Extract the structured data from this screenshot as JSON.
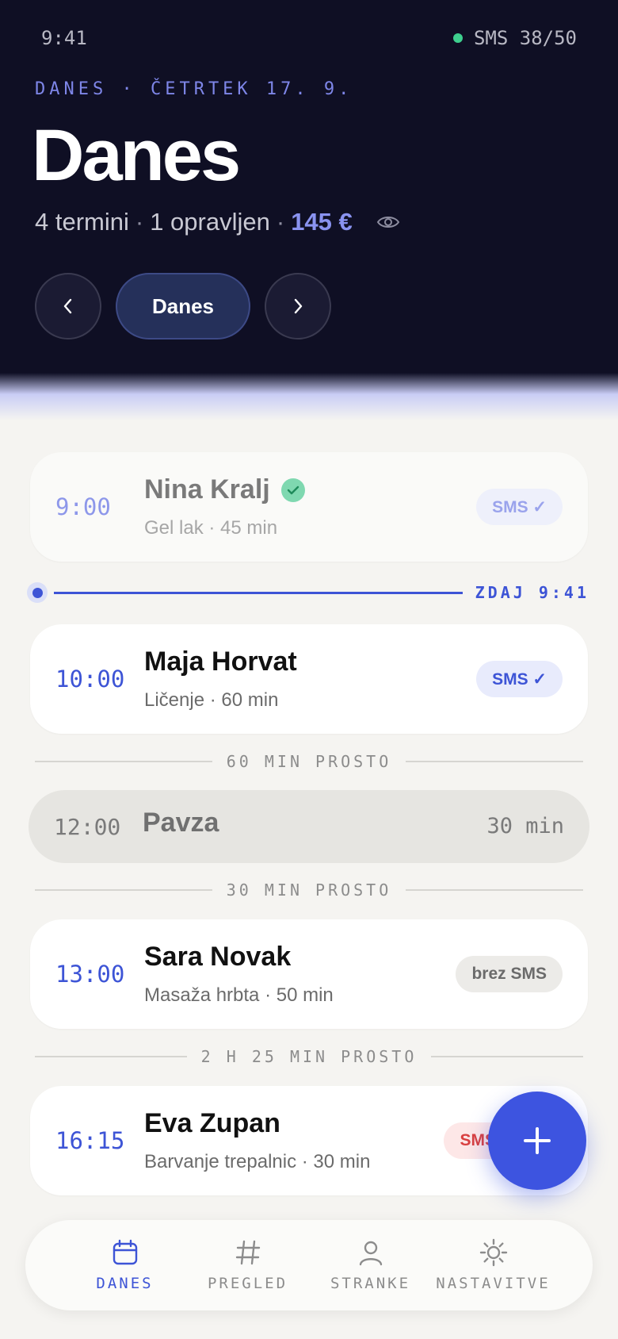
{
  "status_bar": {
    "time": "9:41",
    "sms": "SMS 38/50"
  },
  "header": {
    "date_label": "DANES · ČETRTEK 17. 9.",
    "title": "Danes",
    "summary": {
      "appointments": "4 termini",
      "done": "1 opravljen",
      "amount": "145 €"
    },
    "today_button": "Danes"
  },
  "appointments": [
    {
      "time": "9:00",
      "name": "Nina Kralj",
      "service": "Gel lak · 45 min",
      "badge": "SMS ✓",
      "status": "done"
    },
    {
      "time": "10:00",
      "name": "Maja Horvat",
      "service": "Ličenje · 60 min",
      "badge": "SMS ✓",
      "status": "upcoming"
    },
    {
      "time": "13:00",
      "name": "Sara Novak",
      "service": "Masaža hrbta · 50 min",
      "badge": "brez SMS",
      "status": "upcoming"
    },
    {
      "time": "16:15",
      "name": "Eva Zupan",
      "service": "Barvanje trepalnic · 30 min",
      "badge": "SMS",
      "status": "upcoming"
    }
  ],
  "now_marker": "ZDAJ 9:41",
  "free_slots": [
    "60 MIN PROSTO",
    "30 MIN PROSTO",
    "2 H 25 MIN PROSTO"
  ],
  "pause": {
    "time": "12:00",
    "label": "Pavza",
    "duration": "30 min"
  },
  "tabs": [
    {
      "label": "DANES",
      "icon": "calendar-icon",
      "active": true
    },
    {
      "label": "PREGLED",
      "icon": "hash-icon",
      "active": false
    },
    {
      "label": "STRANKE",
      "icon": "person-icon",
      "active": false
    },
    {
      "label": "NASTAVITVE",
      "icon": "sun-icon",
      "active": false
    }
  ],
  "colors": {
    "accent": "#3d54d6",
    "header_bg": "#0f0f24",
    "success": "#3ecf8e",
    "warning": "#d94040"
  }
}
